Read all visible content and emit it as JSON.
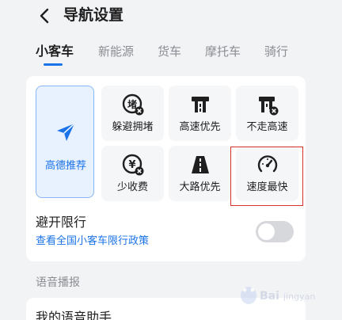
{
  "header": {
    "title": "导航设置"
  },
  "tabs": [
    {
      "label": "小客车",
      "active": true
    },
    {
      "label": "新能源",
      "active": false
    },
    {
      "label": "货车",
      "active": false
    },
    {
      "label": "摩托车",
      "active": false
    },
    {
      "label": "骑行",
      "active": false
    }
  ],
  "route_preferences": {
    "recommended": {
      "label": "高德推荐",
      "icon": "paper-plane-icon",
      "selected": true
    },
    "options": [
      {
        "label": "躲避拥堵",
        "icon": "congestion-avoid-icon"
      },
      {
        "label": "高速优先",
        "icon": "highway-icon"
      },
      {
        "label": "不走高速",
        "icon": "no-highway-icon"
      },
      {
        "label": "少收费",
        "icon": "less-toll-icon"
      },
      {
        "label": "大路优先",
        "icon": "main-road-icon"
      },
      {
        "label": "速度最快",
        "icon": "speedometer-icon"
      }
    ]
  },
  "avoid_restriction": {
    "title": "避开限行",
    "link": "查看全国小客车限行政策",
    "enabled": false
  },
  "voice_section": {
    "label": "语音播报"
  },
  "voice_item": {
    "label": "我的语音助手"
  },
  "colors": {
    "accent": "#1a73e8",
    "highlight": "#d9302c"
  }
}
